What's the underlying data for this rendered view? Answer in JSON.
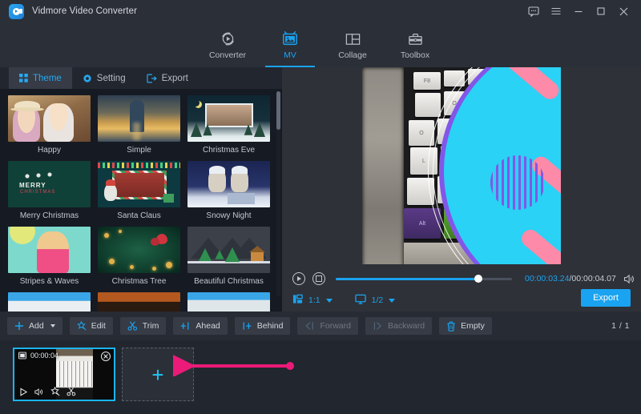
{
  "titlebar": {
    "app_name": "Vidmore Video Converter",
    "icons": [
      "feedback-icon",
      "menu-icon",
      "minimize-icon",
      "maximize-icon",
      "close-icon"
    ]
  },
  "nav": {
    "items": [
      {
        "label": "Converter",
        "icon": "converter-icon",
        "active": false
      },
      {
        "label": "MV",
        "icon": "mv-icon",
        "active": true
      },
      {
        "label": "Collage",
        "icon": "collage-icon",
        "active": false
      },
      {
        "label": "Toolbox",
        "icon": "toolbox-icon",
        "active": false
      }
    ]
  },
  "subtabs": {
    "items": [
      {
        "label": "Theme",
        "icon": "grid-icon",
        "active": true
      },
      {
        "label": "Setting",
        "icon": "gear-icon",
        "active": false
      },
      {
        "label": "Export",
        "icon": "export-icon",
        "active": false
      }
    ]
  },
  "themes": [
    {
      "label": "Happy"
    },
    {
      "label": "Simple"
    },
    {
      "label": "Christmas Eve"
    },
    {
      "label": "Merry Christmas"
    },
    {
      "label": "Santa Claus"
    },
    {
      "label": "Snowy Night"
    },
    {
      "label": "Stripes & Waves"
    },
    {
      "label": "Christmas Tree"
    },
    {
      "label": "Beautiful Christmas"
    }
  ],
  "merry_text": {
    "line1": "MERRY",
    "line2": "CHRISTMAS"
  },
  "player": {
    "play_icon": "play-icon",
    "stop_icon": "stop-icon",
    "progress_percent": 81,
    "current_time": "00:00:03.24",
    "separator": "/",
    "total_time": "00:00:04.07",
    "volume_icon": "volume-icon",
    "aspect_ratio": {
      "icon": "aspect-ratio-icon",
      "value": "1:1"
    },
    "scale": {
      "icon": "screen-icon",
      "value": "1/2"
    },
    "export_label": "Export"
  },
  "toolbar": {
    "buttons": [
      {
        "label": "Add",
        "icon": "plus-icon",
        "has_caret": true,
        "disabled": false
      },
      {
        "label": "Edit",
        "icon": "magic-wand-icon",
        "has_caret": false,
        "disabled": false
      },
      {
        "label": "Trim",
        "icon": "scissors-icon",
        "has_caret": false,
        "disabled": false
      },
      {
        "label": "Ahead",
        "icon": "insert-ahead-icon",
        "has_caret": false,
        "disabled": false
      },
      {
        "label": "Behind",
        "icon": "insert-behind-icon",
        "has_caret": false,
        "disabled": false
      },
      {
        "label": "Forward",
        "icon": "move-forward-icon",
        "has_caret": false,
        "disabled": true
      },
      {
        "label": "Backward",
        "icon": "move-backward-icon",
        "has_caret": false,
        "disabled": true
      },
      {
        "label": "Empty",
        "icon": "trash-icon",
        "has_caret": false,
        "disabled": false
      }
    ],
    "page_indicator": "1 / 1"
  },
  "timeline": {
    "clip": {
      "duration": "00:00:04",
      "film_icon": "film-icon",
      "close_icon": "close-circle-icon",
      "tools": [
        "play-icon",
        "volume-icon",
        "magic-wand-icon",
        "scissors-icon"
      ]
    },
    "add_slot": {
      "label": "+",
      "name": "add-media-slot"
    }
  },
  "annotation": {
    "arrow_color": "#ec1a78",
    "points_to": "add-media-slot"
  },
  "colors": {
    "accent": "#1aa3f0",
    "accent_bright": "#19b5f2",
    "panel_dark": "#161a23",
    "panel_mid": "#272b33",
    "panel_light": "#2e3138",
    "titlebar": "#2b2f38",
    "arrow_pink": "#ec1a78"
  }
}
